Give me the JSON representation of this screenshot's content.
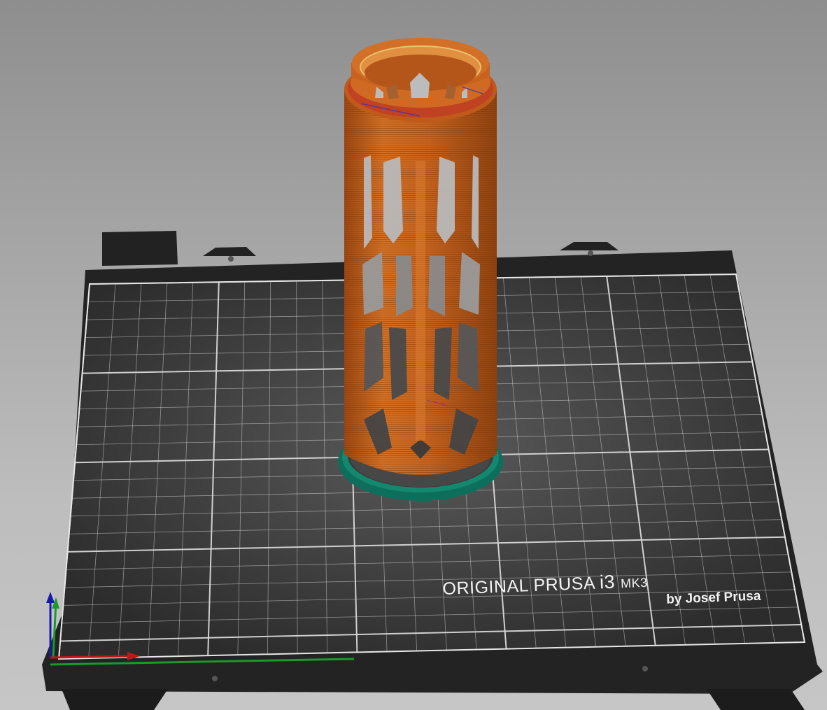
{
  "viewport": {
    "name": "3D print preview",
    "background_color": "#a8a8a8"
  },
  "bed": {
    "brand_line": "ORIGINAL PRUSA",
    "model": "i3",
    "model_suffix": "MK3",
    "maker_line": "by Josef Prusa",
    "surface_color": "#3c3c3c",
    "frame_color": "#222222",
    "grid_color": "#d8d8d8"
  },
  "object": {
    "name": "hollow-lattice-cylinder",
    "perimeter_color": "#c8641e",
    "skirt_color": "#0e7a66",
    "top_ring_color": "#c0302a"
  },
  "axes": {
    "x_color": "#c01818",
    "y_color": "#1a9a2a",
    "z_color": "#1818b0"
  }
}
